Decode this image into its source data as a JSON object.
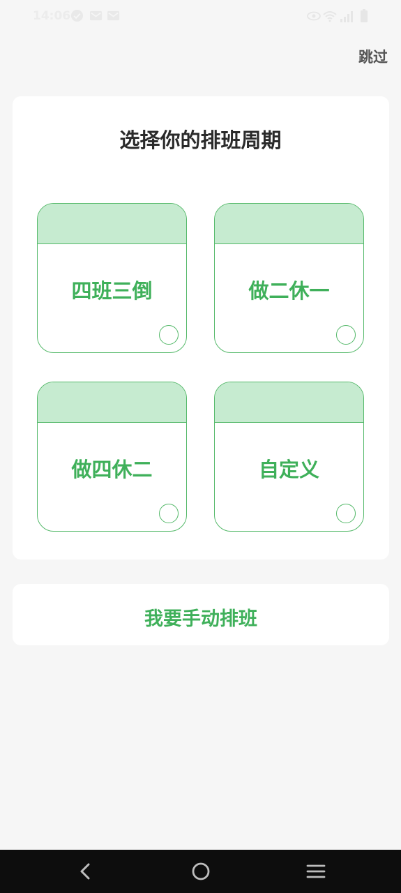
{
  "status_bar": {
    "time": "14:06",
    "left_icons": [
      "check-circle-icon",
      "gmail-icon",
      "mail-icon"
    ],
    "right_icons": [
      "eye-icon",
      "wifi-icon",
      "signal-icon",
      "battery-icon"
    ]
  },
  "header": {
    "skip_label": "跳过"
  },
  "main": {
    "title": "选择你的排班周期",
    "options": [
      {
        "label": "四班三倒",
        "selected": false
      },
      {
        "label": "做二休一",
        "selected": false
      },
      {
        "label": "做四休二",
        "selected": false
      },
      {
        "label": "自定义",
        "selected": false
      }
    ]
  },
  "manual": {
    "label": "我要手动排班"
  },
  "nav_bar": {
    "buttons": [
      "back-icon",
      "home-icon",
      "menu-icon"
    ]
  },
  "colors": {
    "accent": "#3fb05a",
    "accent_light": "#c6ebd0",
    "background": "#f6f6f6",
    "nav_background": "#0d0d0d"
  }
}
